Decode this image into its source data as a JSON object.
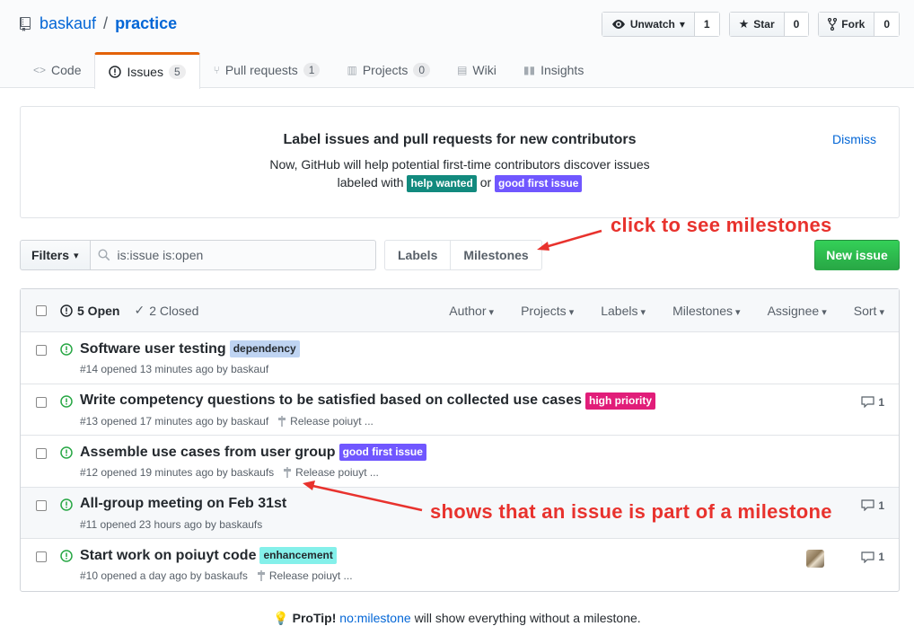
{
  "repo": {
    "owner": "baskauf",
    "separator": "/",
    "name": "practice"
  },
  "actions": [
    {
      "label": "Unwatch",
      "count": "1",
      "icon": "eye-icon"
    },
    {
      "label": "Star",
      "count": "0",
      "icon": "star-icon"
    },
    {
      "label": "Fork",
      "count": "0",
      "icon": "fork-icon"
    }
  ],
  "tabs": [
    {
      "label": "Code",
      "count": ""
    },
    {
      "label": "Issues",
      "count": "5"
    },
    {
      "label": "Pull requests",
      "count": "1"
    },
    {
      "label": "Projects",
      "count": "0"
    },
    {
      "label": "Wiki",
      "count": ""
    },
    {
      "label": "Insights",
      "count": ""
    }
  ],
  "notice": {
    "title": "Label issues and pull requests for new contributors",
    "line1": "Now, GitHub will help potential first-time contributors discover issues",
    "line2_prefix": "labeled with",
    "line2_or": "or",
    "label_help": "help wanted",
    "label_good": "good first issue",
    "dismiss": "Dismiss"
  },
  "filterbar": {
    "filters": "Filters",
    "search_value": "is:issue is:open",
    "labels": "Labels",
    "milestones": "Milestones",
    "new_issue": "New issue"
  },
  "annotations": {
    "milestones": "click to see milestones",
    "issue": "shows that an issue is part of a milestone"
  },
  "table": {
    "open": "5 Open",
    "closed": "2 Closed",
    "sorters": [
      "Author",
      "Projects",
      "Labels",
      "Milestones",
      "Assignee",
      "Sort"
    ]
  },
  "issues": [
    {
      "title": "Software user testing",
      "label": "dependency",
      "meta": "#14 opened 13 minutes ago by baskauf",
      "milestone": "",
      "comments": ""
    },
    {
      "title": "Write competency questions to be satisfied based on collected use cases",
      "label": "high priority",
      "meta": "#13 opened 17 minutes ago by baskauf",
      "milestone": "Release poiuyt ...",
      "comments": "1"
    },
    {
      "title": "Assemble use cases from user group",
      "label": "good first issue",
      "meta": "#12 opened 19 minutes ago by baskaufs",
      "milestone": "Release poiuyt ...",
      "comments": ""
    },
    {
      "title": "All-group meeting on Feb 31st",
      "label": "",
      "meta": "#11 opened 23 hours ago by baskaufs",
      "milestone": "",
      "comments": "1"
    },
    {
      "title": "Start work on poiuyt code",
      "label": "enhancement",
      "meta": "#10 opened a day ago by baskaufs",
      "milestone": "Release poiuyt ...",
      "comments": "1"
    }
  ],
  "colors": {
    "help_wanted": "#128a7e",
    "good_first_issue": "#7057ff",
    "dependency": "#bfd4f2",
    "high_priority": "#e11d79",
    "enhancement": "#84f0ea",
    "open_green": "#28a745",
    "annotation_red": "#e8322d"
  },
  "protip": {
    "bold": "ProTip!",
    "link": "no:milestone",
    "rest": "will show everything without a milestone."
  }
}
